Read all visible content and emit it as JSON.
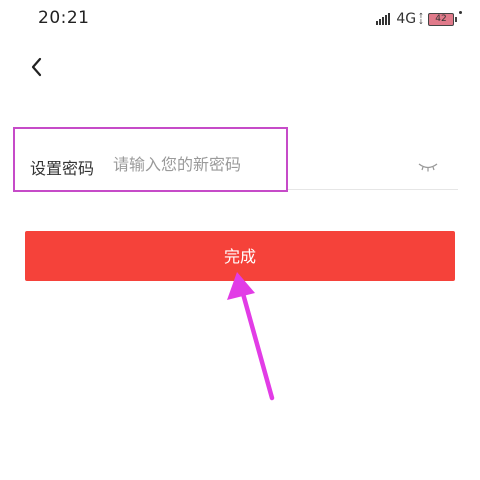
{
  "status_bar": {
    "time": "20:21",
    "network": "4G",
    "battery_level": "42",
    "icons": [
      "signal-icon",
      "network-arrows-icon",
      "battery-icon"
    ]
  },
  "nav": {
    "back_icon": "chevron-left-icon"
  },
  "form": {
    "password_label": "设置密码",
    "password_placeholder": "请输入您的新密码",
    "password_value": "",
    "visibility_icon": "eye-closed-icon"
  },
  "actions": {
    "done_label": "完成"
  },
  "colors": {
    "primary_button": "#f5423a",
    "highlight": "#c64bc8",
    "annotation_arrow": "#e23ce6"
  }
}
